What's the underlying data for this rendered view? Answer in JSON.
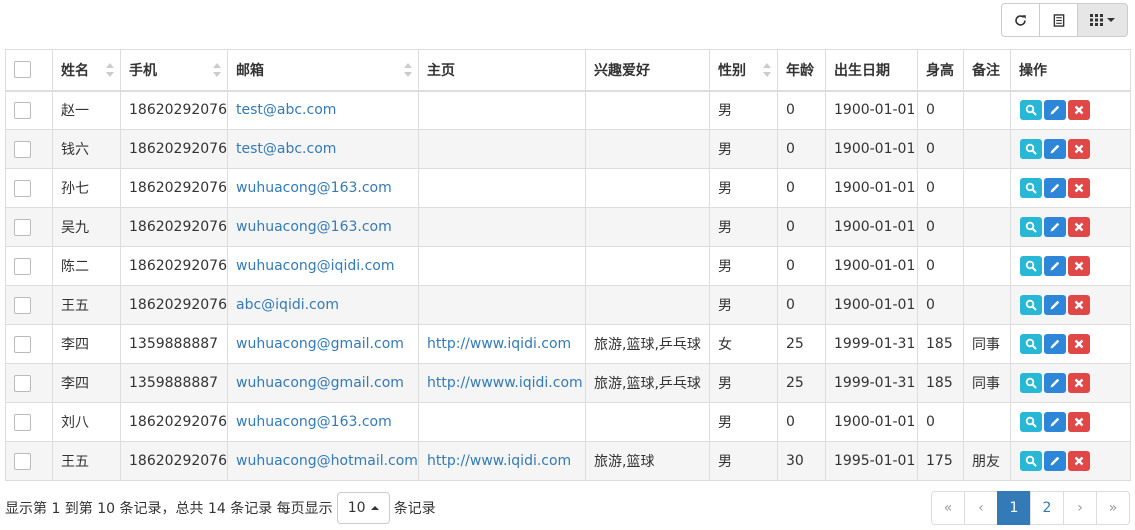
{
  "toolbar": {
    "buttons": [
      {
        "icon": "refresh-icon"
      },
      {
        "icon": "toggle-view-icon"
      },
      {
        "icon": "columns-icon"
      }
    ]
  },
  "table": {
    "headers": [
      "姓名",
      "手机",
      "邮箱",
      "主页",
      "兴趣爱好",
      "性别",
      "年龄",
      "出生日期",
      "身高",
      "备注",
      "操作"
    ],
    "rows": [
      {
        "name": "赵一",
        "phone": "18620292076",
        "email": "test@abc.com",
        "homepage": "",
        "hobbies": "",
        "gender": "男",
        "age": "0",
        "birth": "1900-01-01",
        "height": "0",
        "note": ""
      },
      {
        "name": "钱六",
        "phone": "18620292076",
        "email": "test@abc.com",
        "homepage": "",
        "hobbies": "",
        "gender": "男",
        "age": "0",
        "birth": "1900-01-01",
        "height": "0",
        "note": ""
      },
      {
        "name": "孙七",
        "phone": "18620292076",
        "email": "wuhuacong@163.com",
        "homepage": "",
        "hobbies": "",
        "gender": "男",
        "age": "0",
        "birth": "1900-01-01",
        "height": "0",
        "note": ""
      },
      {
        "name": "吴九",
        "phone": "18620292076",
        "email": "wuhuacong@163.com",
        "homepage": "",
        "hobbies": "",
        "gender": "男",
        "age": "0",
        "birth": "1900-01-01",
        "height": "0",
        "note": ""
      },
      {
        "name": "陈二",
        "phone": "18620292076",
        "email": "wuhuacong@iqidi.com",
        "homepage": "",
        "hobbies": "",
        "gender": "男",
        "age": "0",
        "birth": "1900-01-01",
        "height": "0",
        "note": ""
      },
      {
        "name": "王五",
        "phone": "18620292076",
        "email": "abc@iqidi.com",
        "homepage": "",
        "hobbies": "",
        "gender": "男",
        "age": "0",
        "birth": "1900-01-01",
        "height": "0",
        "note": ""
      },
      {
        "name": "李四",
        "phone": "1359888887",
        "email": "wuhuacong@gmail.com",
        "homepage": "http://www.iqidi.com",
        "hobbies": "旅游,篮球,乒乓球",
        "gender": "女",
        "age": "25",
        "birth": "1999-01-31",
        "height": "185",
        "note": "同事"
      },
      {
        "name": "李四",
        "phone": "1359888887",
        "email": "wuhuacong@gmail.com",
        "homepage": "http://wwww.iqidi.com",
        "hobbies": "旅游,篮球,乒乓球",
        "gender": "男",
        "age": "25",
        "birth": "1999-01-31",
        "height": "185",
        "note": "同事"
      },
      {
        "name": "刘八",
        "phone": "18620292076",
        "email": "wuhuacong@163.com",
        "homepage": "",
        "hobbies": "",
        "gender": "男",
        "age": "0",
        "birth": "1900-01-01",
        "height": "0",
        "note": ""
      },
      {
        "name": "王五",
        "phone": "18620292076",
        "email": "wuhuacong@hotmail.com",
        "homepage": "http://www.iqidi.com",
        "hobbies": "旅游,篮球",
        "gender": "男",
        "age": "30",
        "birth": "1995-01-01",
        "height": "175",
        "note": "朋友"
      }
    ]
  },
  "footer": {
    "summary": "显示第 1 到第 10 条记录，总共 14 条记录 每页显示",
    "page_size": "10",
    "suffix": "条记录"
  },
  "pager": {
    "first": "«",
    "prev": "‹",
    "pages": [
      "1",
      "2"
    ],
    "next": "›",
    "last": "»"
  },
  "colors": {
    "view": "#28b8d6",
    "edit": "#2e86d9",
    "delete": "#e04848",
    "link": "#337ab7",
    "active_page": "#337ab7"
  }
}
